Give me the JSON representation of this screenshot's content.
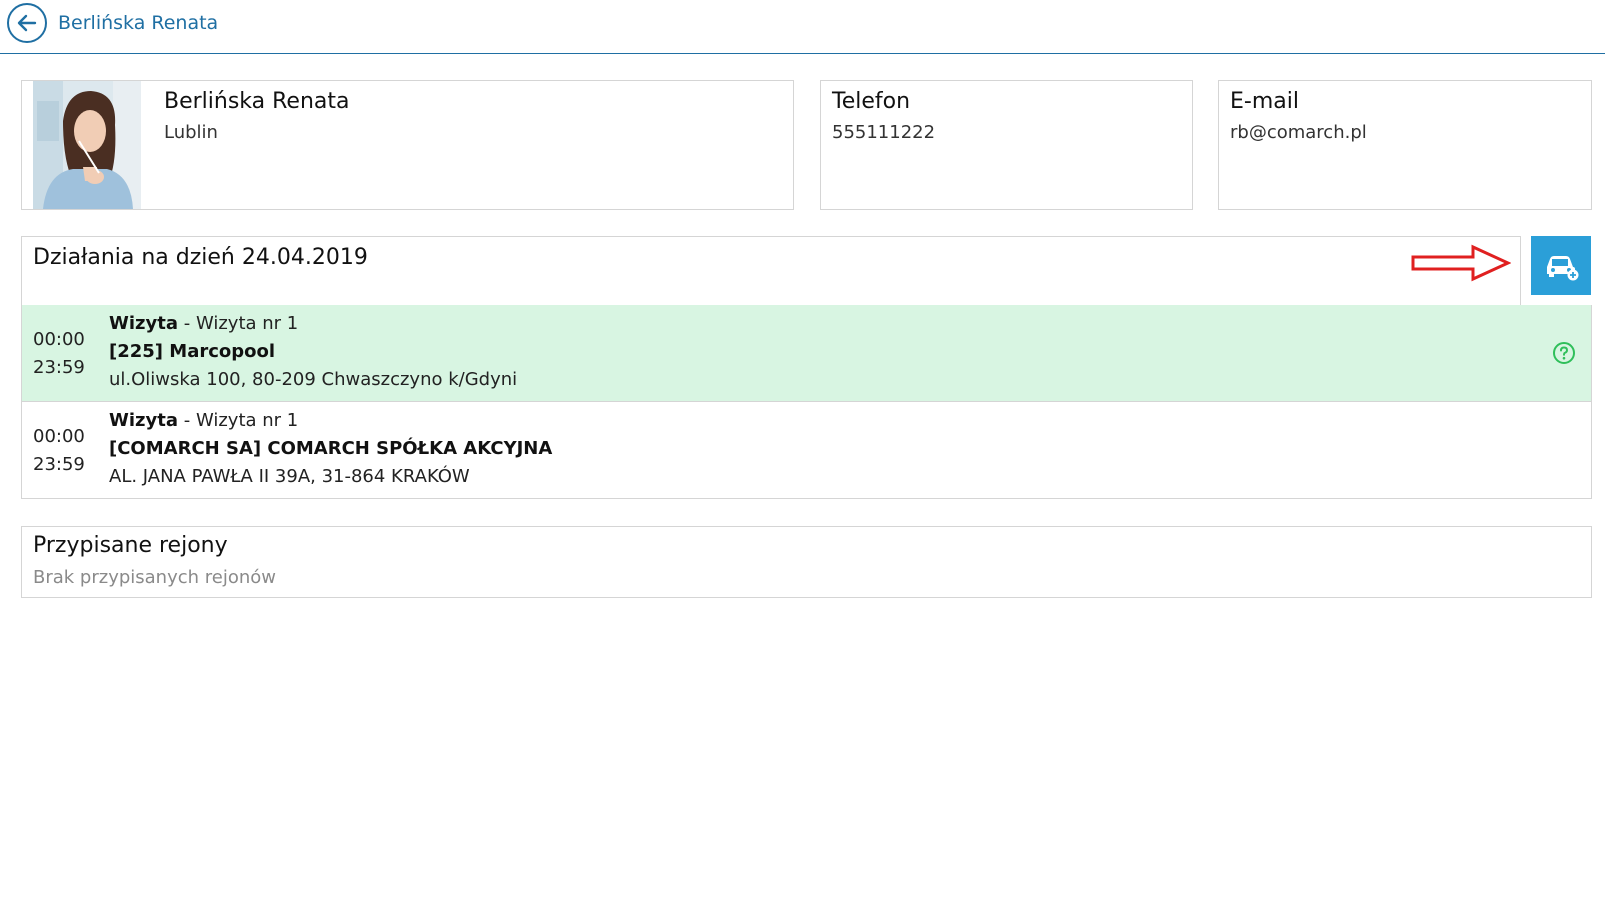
{
  "header": {
    "title": "Berlińska Renata",
    "back_icon": "arrow-left-icon",
    "accent_color": "#1f6fa3"
  },
  "profile": {
    "name": "Berlińska Renata",
    "city": "Lublin"
  },
  "phone": {
    "label": "Telefon",
    "value": "555111222"
  },
  "email": {
    "label": "E-mail",
    "value": "rb@comarch.pl"
  },
  "activities": {
    "title": "Działania na dzień 24.04.2019",
    "add_button_icon": "car-add-icon",
    "add_button_color": "#2b9fd8",
    "items": [
      {
        "start": "00:00",
        "end": "23:59",
        "type": "Wizyta",
        "separator": " - ",
        "name": "Wizyta nr 1",
        "customer": "[225] Marcopool",
        "address": "ul.Oliwska 100, 80-209 Chwaszczyno k/Gdyni",
        "status_icon": "question-circle-icon",
        "highlight_color": "#d8f5e2"
      },
      {
        "start": "00:00",
        "end": "23:59",
        "type": "Wizyta",
        "separator": " - ",
        "name": "Wizyta nr 1",
        "customer": "[COMARCH SA] COMARCH SPÓŁKA AKCYJNA",
        "address": "AL. JANA PAWŁA II 39A, 31-864 KRAKÓW"
      }
    ]
  },
  "regions": {
    "title": "Przypisane rejony",
    "empty_text": "Brak przypisanych rejonów"
  }
}
